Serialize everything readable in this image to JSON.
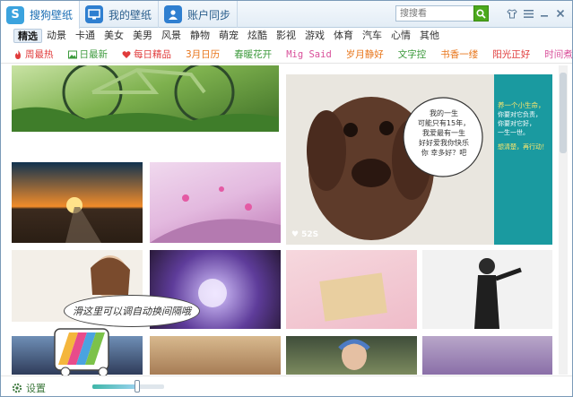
{
  "tabs": [
    {
      "label": "搜狗壁纸",
      "icon": "sogou-logo-icon",
      "color": "#3ba3de"
    },
    {
      "label": "我的壁纸",
      "icon": "monitor-icon",
      "color": "#2f7fd0"
    },
    {
      "label": "账户同步",
      "icon": "user-icon",
      "color": "#2f7fd0"
    }
  ],
  "search": {
    "placeholder": "搜搜看"
  },
  "categories": [
    "精选",
    "动景",
    "卡通",
    "美女",
    "美男",
    "风景",
    "静物",
    "萌宠",
    "炫酷",
    "影视",
    "游戏",
    "体育",
    "汽车",
    "心情",
    "其他"
  ],
  "active_category": "精选",
  "subcategories": [
    {
      "label": "周最热",
      "color": "#e03b3b",
      "icon": "fire-icon"
    },
    {
      "label": "日最新",
      "color": "#3c9a3c",
      "icon": "picture-icon"
    },
    {
      "label": "每日精品",
      "color": "#e03b3b",
      "icon": "heart-icon"
    },
    {
      "label": "3月日历",
      "color": "#e8751a",
      "icon": ""
    },
    {
      "label": "春暖花开",
      "color": "#3c9a3c",
      "icon": ""
    },
    {
      "label": "Mig Said",
      "color": "#d94f9a",
      "icon": ""
    },
    {
      "label": "岁月静好",
      "color": "#e8751a",
      "icon": ""
    },
    {
      "label": "文字控",
      "color": "#3c9a3c",
      "icon": ""
    },
    {
      "label": "书香一缕",
      "color": "#e8751a",
      "icon": ""
    },
    {
      "label": "阳光正好",
      "color": "#e03b3b",
      "icon": ""
    },
    {
      "label": "时间煮雨",
      "color": "#d94f9a",
      "icon": ""
    }
  ],
  "featured": {
    "quote_lines": [
      "我的一生",
      "可能只有15年，",
      "我爱最有一生",
      "好好爱我你快乐",
      "你 幸多好？吧"
    ],
    "side_title": "养一个小生命，",
    "side_lines": [
      "你要对它负责，",
      "你要对它好，",
      "一生一世。"
    ],
    "side_cta": "想清楚，再行动！",
    "watermark": "52S"
  },
  "bubble": {
    "text": "滑这里可以调自动换间隔哦"
  },
  "footer": {
    "settings_label": "设置",
    "interval_level": 0.62
  }
}
